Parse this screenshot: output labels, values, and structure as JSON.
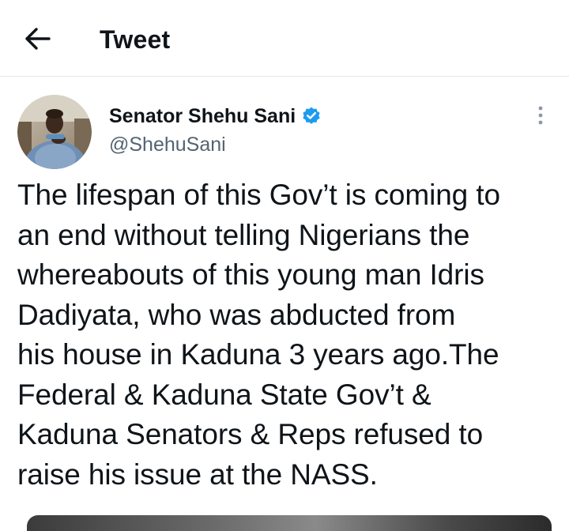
{
  "header": {
    "title": "Tweet",
    "back_icon": "arrow-left-icon"
  },
  "tweet": {
    "author": {
      "name": "Senator Shehu Sani",
      "handle": "@ShehuSani",
      "verified": true,
      "verified_color": "#1d9bf0",
      "avatar_icon": "avatar-photo"
    },
    "more_icon": "more-vertical-icon",
    "text": "The lifespan of this Gov’t is coming to\nan end without telling Nigerians the\nwhereabouts of this young man Idris\nDadiyata, who was abducted from\nhis house in Kaduna 3 years ago.The\nFederal & Kaduna State Gov’t &\nKaduna Senators & Reps refused to\nraise his issue at the NASS."
  },
  "colors": {
    "text_primary": "#0f1419",
    "text_secondary": "#536471",
    "divider": "#e6e6e6",
    "accent": "#1d9bf0"
  }
}
